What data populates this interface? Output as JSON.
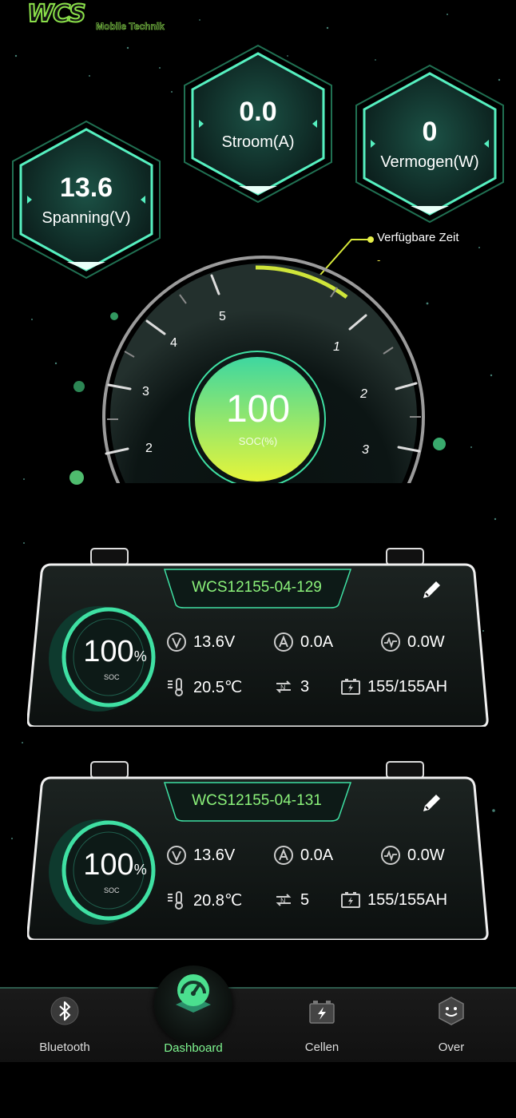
{
  "logo": {
    "mark": "WCS",
    "subtitle": "Mobile Technik"
  },
  "metrics": {
    "voltage": {
      "value": "13.6",
      "label": "Spanning(V)"
    },
    "current": {
      "value": "0.0",
      "label": "Stroom(A)"
    },
    "power": {
      "value": "0",
      "label": "Vermogen(W)"
    }
  },
  "available_time": {
    "label": "Verfügbare  Zeit",
    "value": "-"
  },
  "gauge": {
    "soc_value": "100",
    "soc_label": "SOC(%)",
    "ticks_left": [
      "2",
      "3",
      "4",
      "5"
    ],
    "ticks_right": [
      "1",
      "2",
      "3"
    ]
  },
  "batteries": [
    {
      "name": "WCS12155-04-129",
      "soc_percent": "100",
      "percent_sign": "%",
      "soc_label": "SOC",
      "voltage": "13.6V",
      "current": "0.0A",
      "power": "0.0W",
      "temperature": "20.5℃",
      "cycles": "3",
      "capacity": "155/155AH"
    },
    {
      "name": "WCS12155-04-131",
      "soc_percent": "100",
      "percent_sign": "%",
      "soc_label": "SOC",
      "voltage": "13.6V",
      "current": "0.0A",
      "power": "0.0W",
      "temperature": "20.8℃",
      "cycles": "5",
      "capacity": "155/155AH"
    }
  ],
  "nav": {
    "items": [
      {
        "label": "Bluetooth",
        "icon": "bluetooth-icon"
      },
      {
        "label": "Dashboard",
        "icon": "speedometer-icon",
        "active": true
      },
      {
        "label": "Cellen",
        "icon": "battery-cell-icon"
      },
      {
        "label": "Over",
        "icon": "smiley-icon"
      }
    ]
  },
  "colors": {
    "accent": "#3fe0a3",
    "accent_green": "#7df58f",
    "gauge_yellow": "#e3ef2c",
    "background": "#000000"
  }
}
